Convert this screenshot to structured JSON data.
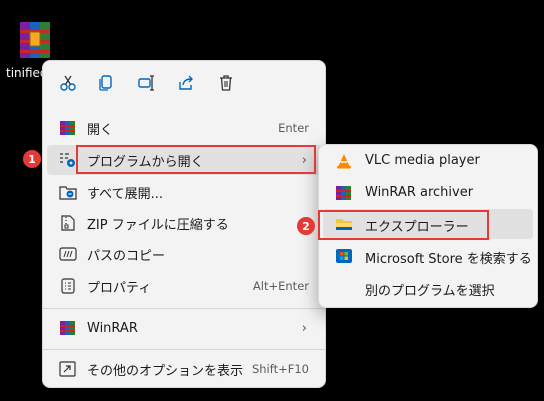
{
  "desktop": {
    "file_label": "tinified"
  },
  "main_menu": {
    "toolbar": [
      {
        "name": "cut-icon"
      },
      {
        "name": "copy-icon"
      },
      {
        "name": "rename-icon"
      },
      {
        "name": "share-icon"
      },
      {
        "name": "delete-icon"
      }
    ],
    "items": [
      {
        "label": "開く",
        "shortcut": "Enter"
      },
      {
        "label": "プログラムから開く",
        "shortcut": ""
      },
      {
        "label": "すべて展開...",
        "shortcut": ""
      },
      {
        "label": "ZIP ファイルに圧縮する",
        "shortcut": ""
      },
      {
        "label": "パスのコピー",
        "shortcut": ""
      },
      {
        "label": "プロパティ",
        "shortcut": "Alt+Enter"
      },
      {
        "label": "WinRAR",
        "shortcut": ""
      },
      {
        "label": "その他のオプションを表示",
        "shortcut": "Shift+F10"
      }
    ]
  },
  "submenu": {
    "items": [
      {
        "label": "VLC media player"
      },
      {
        "label": "WinRAR archiver"
      },
      {
        "label": "エクスプローラー"
      },
      {
        "label": "Microsoft Store を検索する"
      },
      {
        "label": "別のプログラムを選択"
      }
    ]
  },
  "annotations": {
    "badge1": "1",
    "badge2": "2"
  },
  "colors": {
    "highlight": "#e53935",
    "accent": "#0067c0"
  }
}
